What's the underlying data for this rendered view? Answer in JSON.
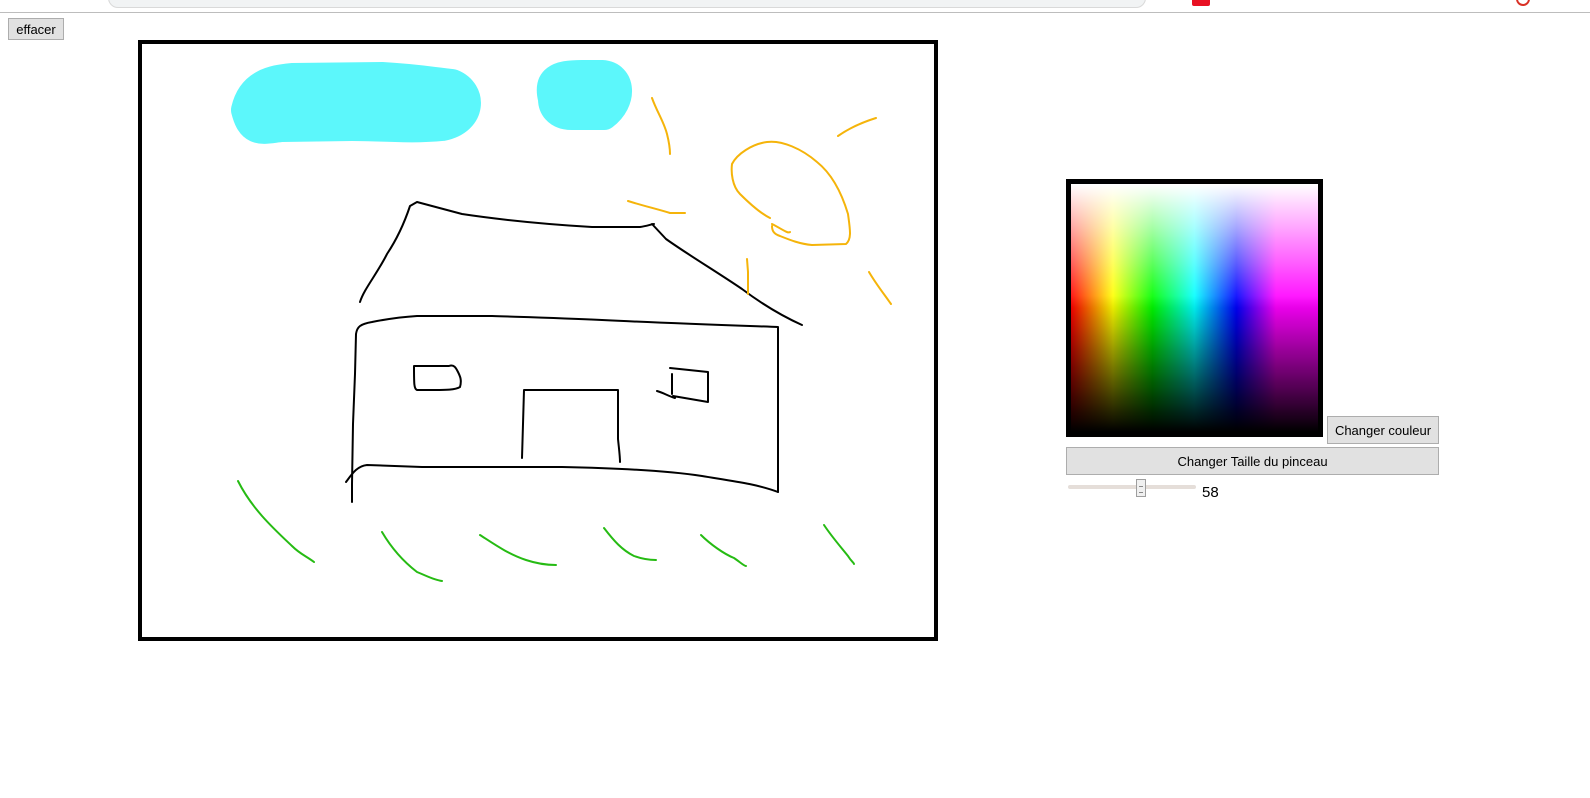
{
  "toolbar": {
    "clear_label": "effacer"
  },
  "controls": {
    "change_color_label": "Changer couleur",
    "change_size_label": "Changer Taille du pinceau",
    "brush_size": 58,
    "brush_size_min": 0,
    "brush_size_max": 100
  },
  "drawing": {
    "colors": {
      "house": "#000000",
      "cloud": "#5cf7fb",
      "sun": "#f5b40a",
      "grass": "#26bb13"
    }
  }
}
